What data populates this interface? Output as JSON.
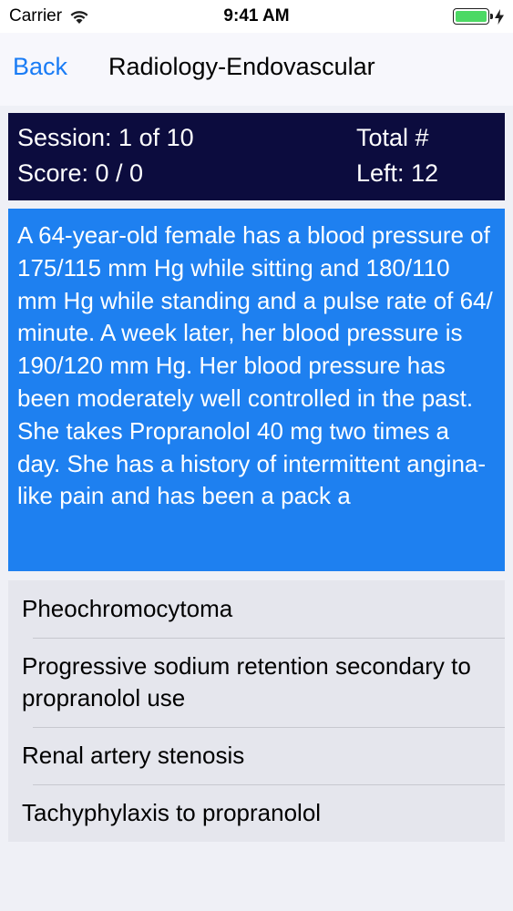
{
  "status_bar": {
    "carrier": "Carrier",
    "time": "9:41 AM",
    "wifi_icon": "wifi-icon",
    "battery_icon": "battery-full-icon",
    "charging_icon": "charging-bolt-icon"
  },
  "nav": {
    "back_label": "Back",
    "title": "Radiology-Endovascular"
  },
  "session": {
    "session_label": "Session: 1 of 10",
    "score_label": "Score: 0 / 0",
    "total_label": "Total #",
    "left_label": "Left: 12"
  },
  "question": {
    "text": "A 64-year-old female has a blood pressure of 175/115 mm Hg while sitting and 180/110 mm Hg while standing and a pulse rate of 64/ minute. A week later, her blood pressure is 190/120 mm Hg. Her blood pressure has been moderately well controlled in the past. She takes Propranolol 40 mg two times a day. She has a history of intermittent angina-like pain and has been a pack a"
  },
  "answers": [
    {
      "label": "Pheochromocytoma"
    },
    {
      "label": "Progressive sodium retention secondary to propranolol use"
    },
    {
      "label": "Renal artery stenosis"
    },
    {
      "label": "Tachyphylaxis to propranolol"
    }
  ],
  "colors": {
    "accent": "#1a7cf5",
    "session_bg": "#0c0c3e",
    "question_bg": "#1e80f0",
    "battery": "#4cd964"
  }
}
